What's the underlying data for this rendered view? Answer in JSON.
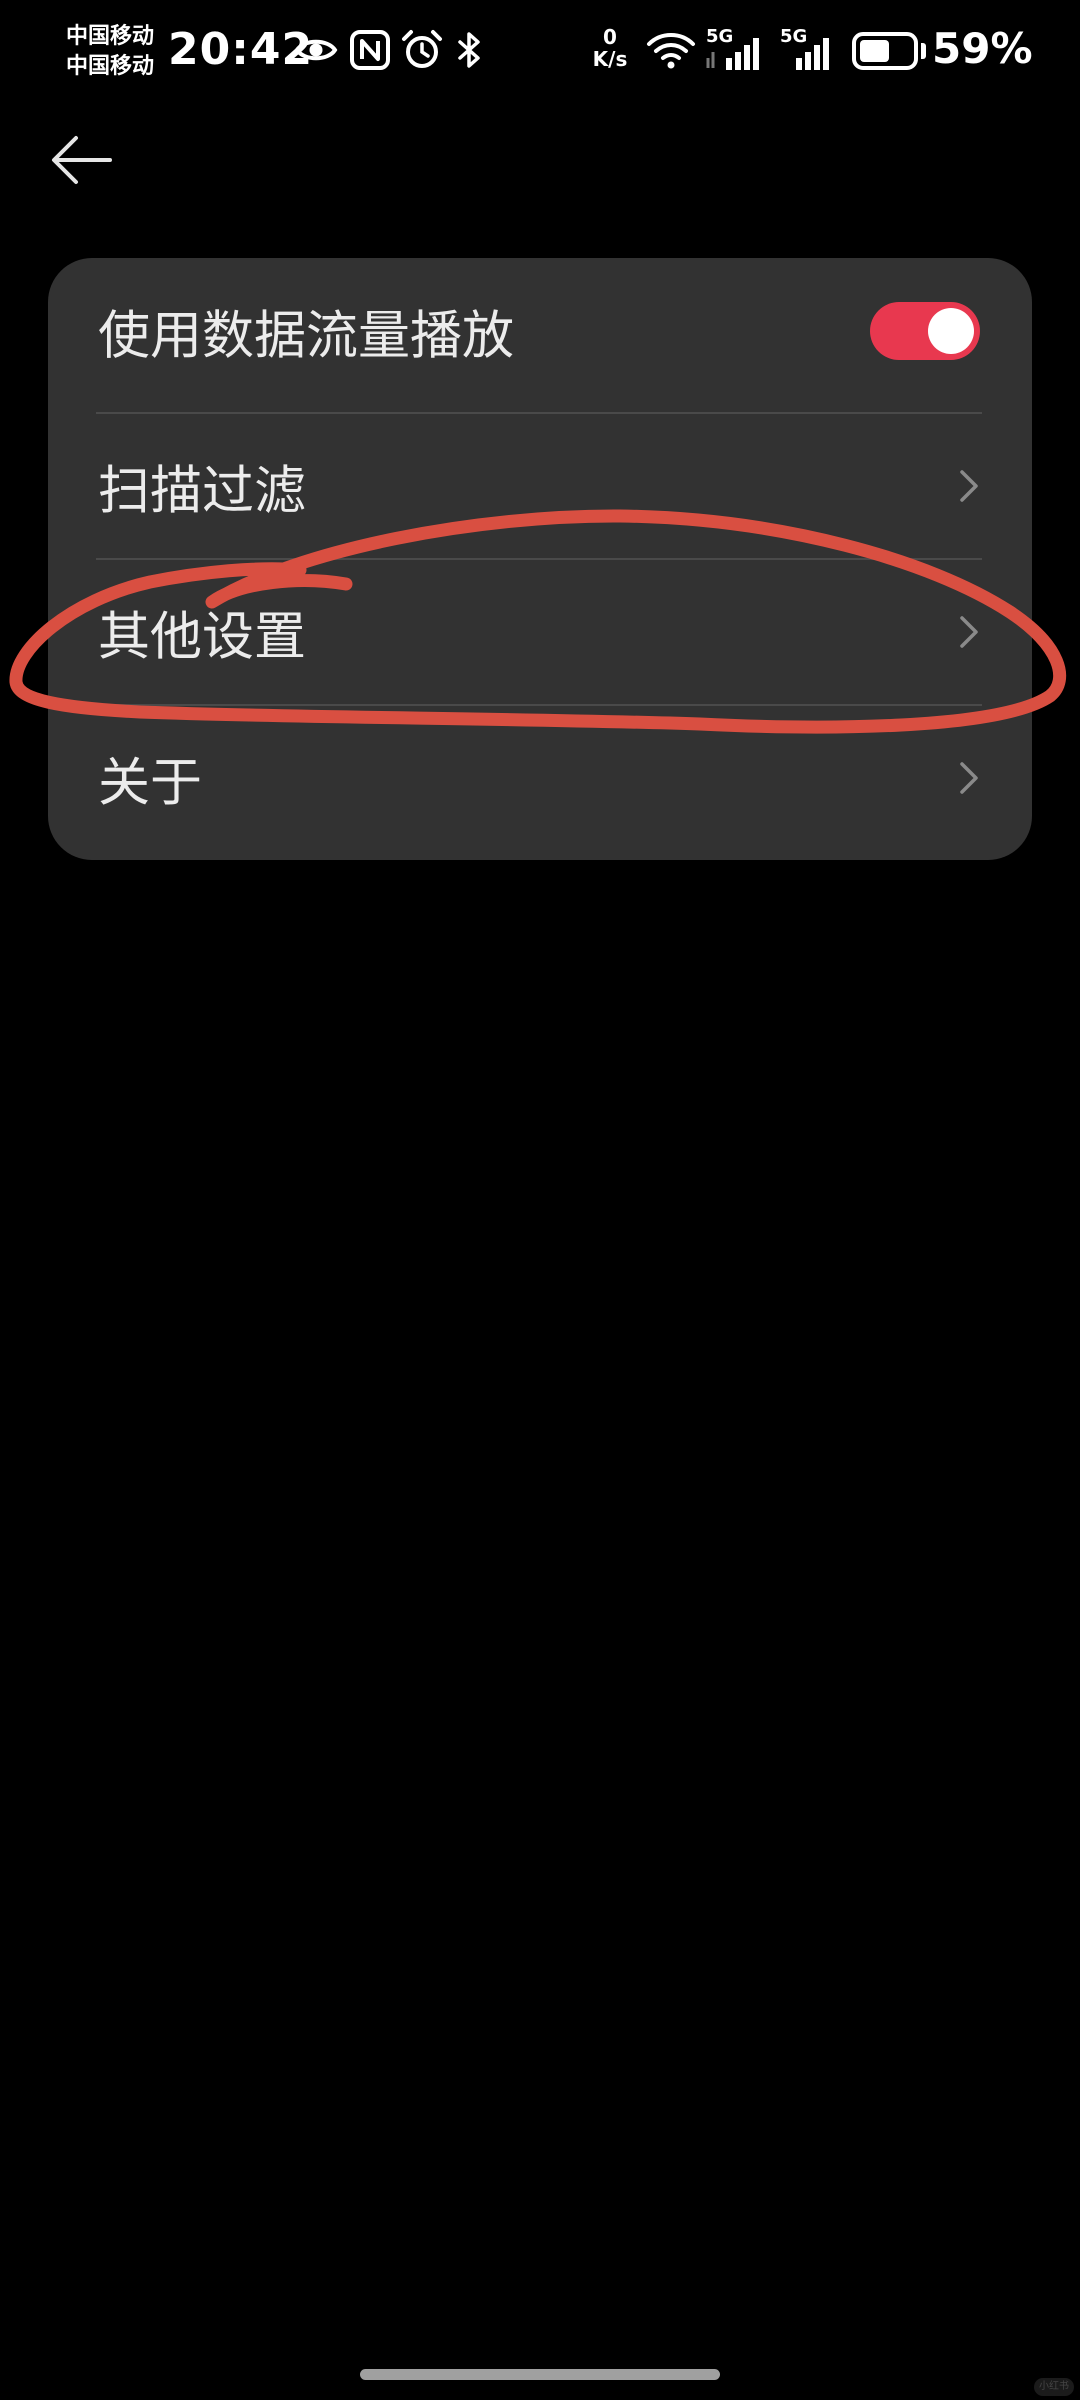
{
  "status_bar": {
    "carrier_1": "中国移动",
    "carrier_2": "中国移动",
    "time": "20:42",
    "net_speed_value": "0",
    "net_speed_unit": "K/s",
    "sim1_label": "5G",
    "sim2_label": "5G",
    "battery_percent": "59%",
    "battery_level": 0.59,
    "icons": [
      "eye-icon",
      "nfc-icon",
      "alarm-icon",
      "bluetooth-icon",
      "wifi-icon",
      "signal-icon",
      "signal-icon",
      "battery-icon"
    ]
  },
  "header": {
    "back_icon": "arrow-left-icon"
  },
  "settings": {
    "items": [
      {
        "label": "使用数据流量播放",
        "control": "toggle",
        "checked": true
      },
      {
        "label": "扫描过滤",
        "control": "chevron"
      },
      {
        "label": "其他设置",
        "control": "chevron"
      },
      {
        "label": "关于",
        "control": "chevron"
      }
    ]
  },
  "colors": {
    "background": "#000000",
    "card": "#323232",
    "toggle_on": "#e8384f",
    "annotation": "#d94f41",
    "text": "#ececec",
    "chevron": "#8a8a8a"
  },
  "watermark": "小红书"
}
